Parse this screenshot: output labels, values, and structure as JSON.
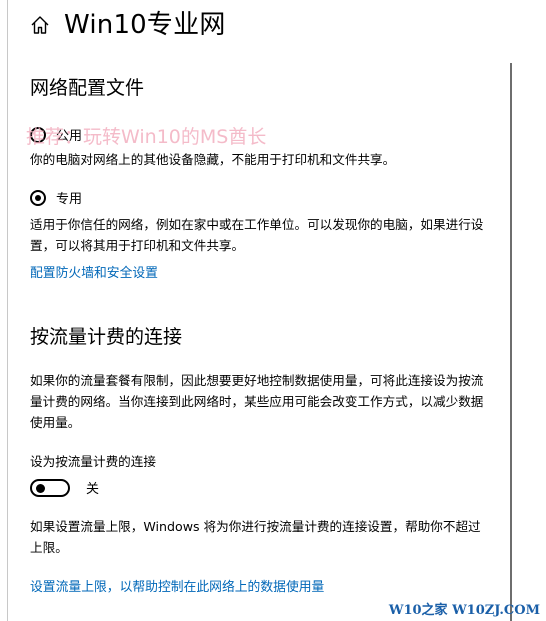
{
  "header": {
    "home_icon": "home-icon",
    "title": "Win10专业网"
  },
  "network_profile": {
    "title": "网络配置文件",
    "options": [
      {
        "label": "公用",
        "description": "你的电脑对网络上的其他设备隐藏，不能用于打印机和文件共享。",
        "selected": false
      },
      {
        "label": "专用",
        "description": "适用于你信任的网络，例如在家中或在工作单位。可以发现你的电脑，如果进行设置，可以将其用于打印机和文件共享。",
        "selected": true
      }
    ],
    "firewall_link": "配置防火墙和安全设置"
  },
  "metered": {
    "title": "按流量计费的连接",
    "description": "如果你的流量套餐有限制，因此想要更好地控制数据使用量，可将此连接设为按流量计费的网络。当你连接到此网络时，某些应用可能会改变工作方式，以减少数据使用量。",
    "toggle_label": "设为按流量计费的连接",
    "toggle_state": "关",
    "toggle_on": false,
    "limit_note": "如果设置流量上限，Windows 将为你进行按流量计费的连接设置，帮助你不超过上限。",
    "limit_link": "设置流量上限，以帮助控制在此网络上的数据使用量"
  },
  "overlay": {
    "watermark": "推荐：玩转Win10的MS酋长",
    "corner_mark": "W10之家 W10ZJ.COM"
  },
  "colors": {
    "link": "#0067b8",
    "watermark": "#f3b0c0",
    "corner_mark": "#1a5fa8"
  }
}
